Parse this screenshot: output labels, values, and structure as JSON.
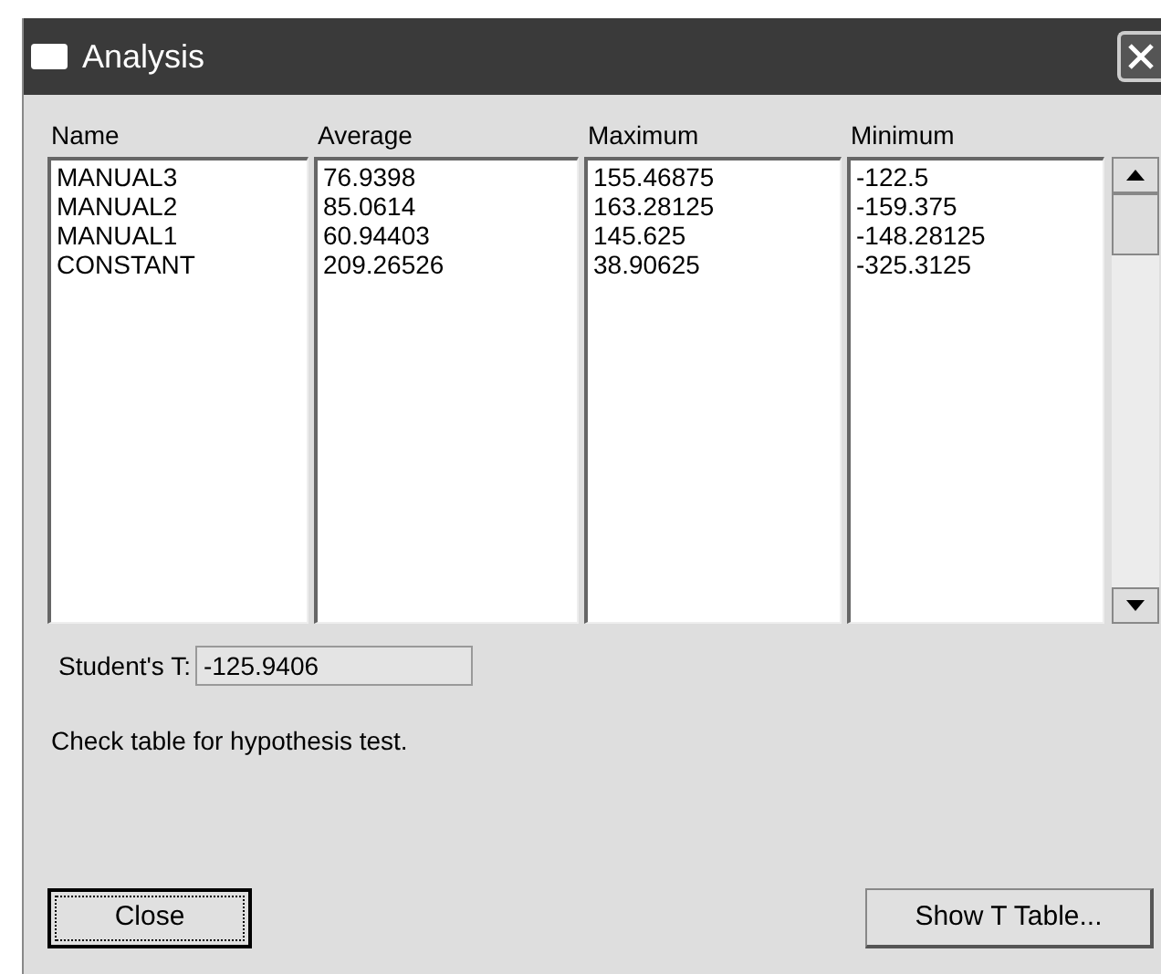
{
  "window": {
    "title": "Analysis"
  },
  "columns": [
    {
      "header": "Name",
      "items": [
        "MANUAL3",
        "MANUAL2",
        "MANUAL1",
        "CONSTANT"
      ]
    },
    {
      "header": "Average",
      "items": [
        "76.9398",
        "85.0614",
        "60.94403",
        "209.26526"
      ]
    },
    {
      "header": "Maximum",
      "items": [
        "155.46875",
        "163.28125",
        "145.625",
        "38.90625"
      ]
    },
    {
      "header": "Minimum",
      "items": [
        "-122.5",
        "-159.375",
        "-148.28125",
        "-325.3125"
      ]
    }
  ],
  "students_t": {
    "label": "Student's T:",
    "value": "-125.9406"
  },
  "message": "Check table for hypothesis test.",
  "buttons": [
    {
      "label": "Close",
      "default": true
    },
    {
      "label": "Show T Table...",
      "default": false
    }
  ]
}
